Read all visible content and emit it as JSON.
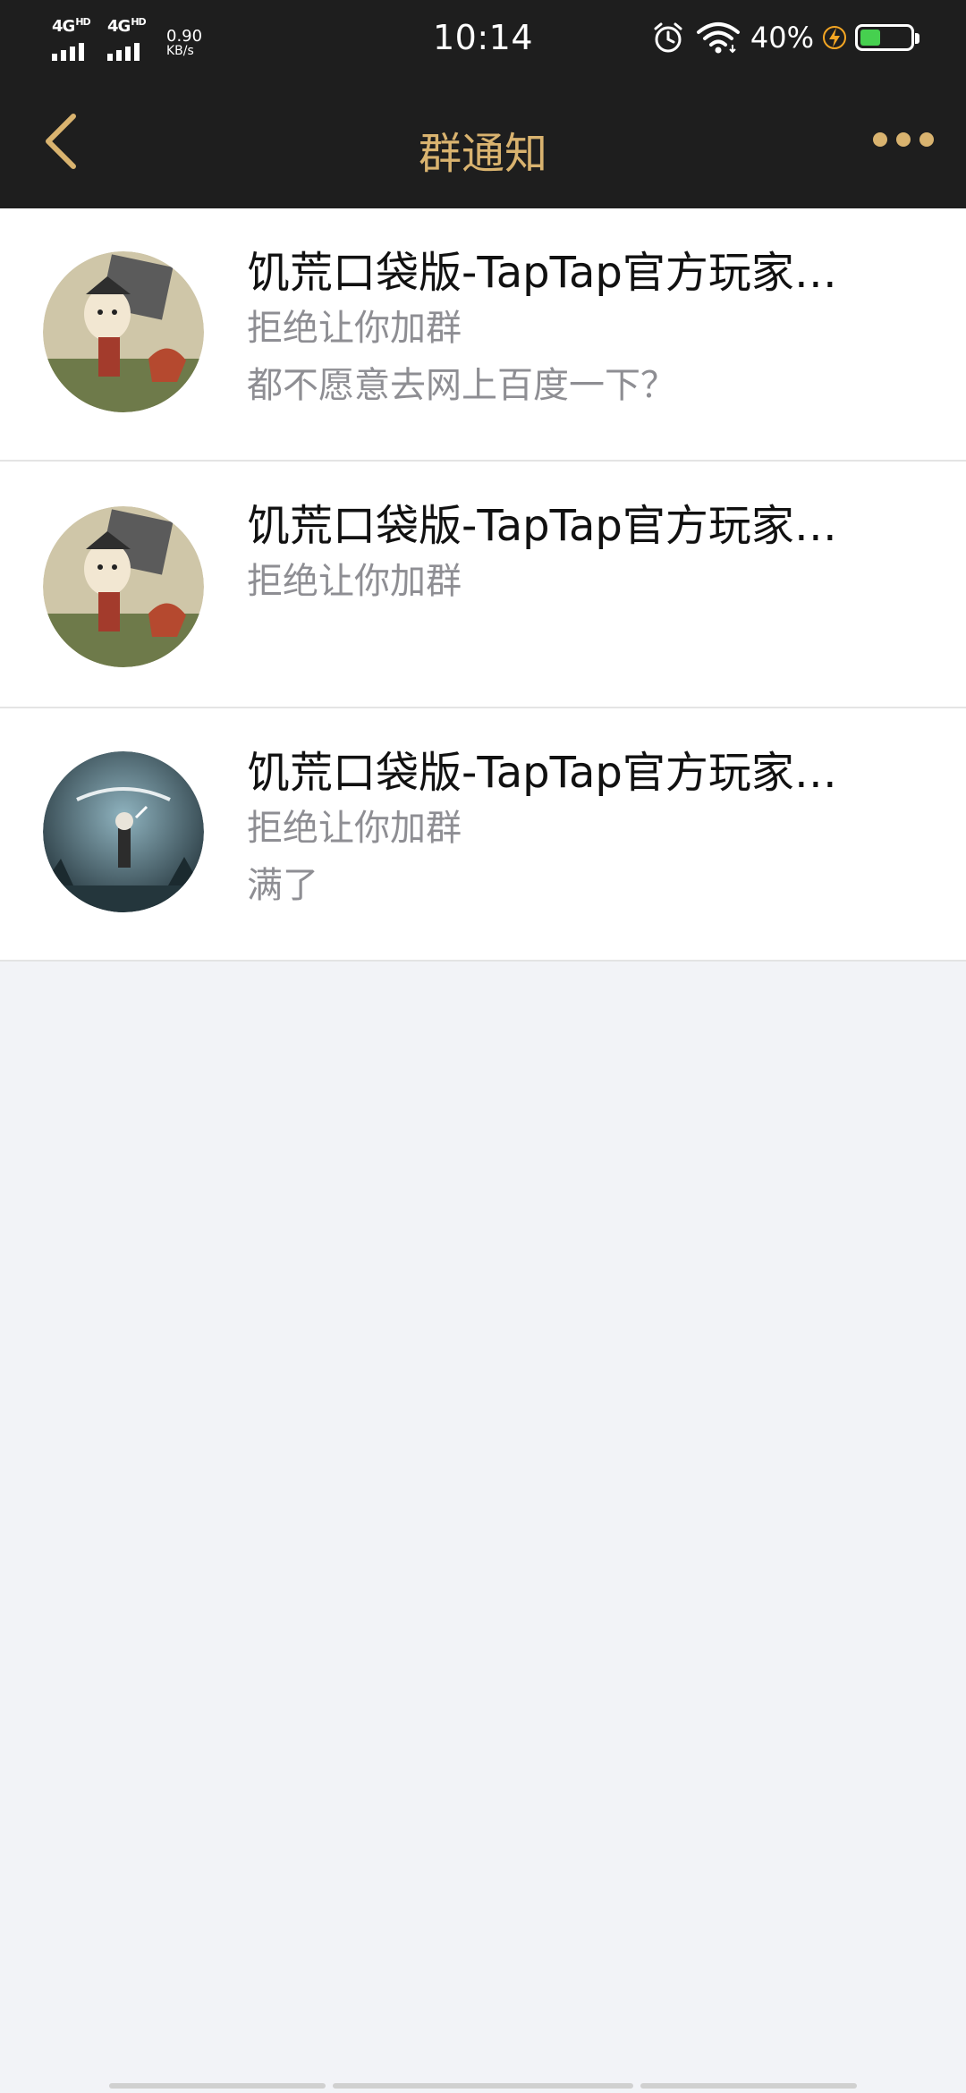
{
  "status_bar": {
    "network1": "4G",
    "network1_sup": "HD",
    "network2": "4G",
    "network2_sup": "HD",
    "speed_value": "0.90",
    "speed_unit": "KB/s",
    "time": "10:14",
    "battery_percent": "40%",
    "battery_level": 0.4,
    "icons": [
      "signal-bars-icon",
      "alarm-icon",
      "wifi-icon",
      "charging-bolt-icon",
      "battery-icon"
    ]
  },
  "nav": {
    "title": "群通知",
    "back_icon": "back-chevron-icon",
    "more_icon": "more-dots-icon"
  },
  "notifications": [
    {
      "group_name": "饥荒口袋版-TapTap官方玩家…",
      "status": "拒绝让你加群",
      "reason": "都不愿意去网上百度一下？",
      "avatar": "wilson-character-avatar"
    },
    {
      "group_name": "饥荒口袋版-TapTap官方玩家…",
      "status": "拒绝让你加群",
      "reason": "",
      "avatar": "wilson-character-avatar"
    },
    {
      "group_name": "饥荒口袋版-TapTap官方玩家…",
      "status": "拒绝让你加群",
      "reason": "满了",
      "avatar": "dont-starve-logo-avatar"
    }
  ],
  "colors": {
    "header_bg": "#1E1E1E",
    "accent_gold": "#D9B36F",
    "page_bg": "#F2F3F7",
    "secondary_text": "#8E8E93",
    "battery_green": "#46D04F"
  }
}
